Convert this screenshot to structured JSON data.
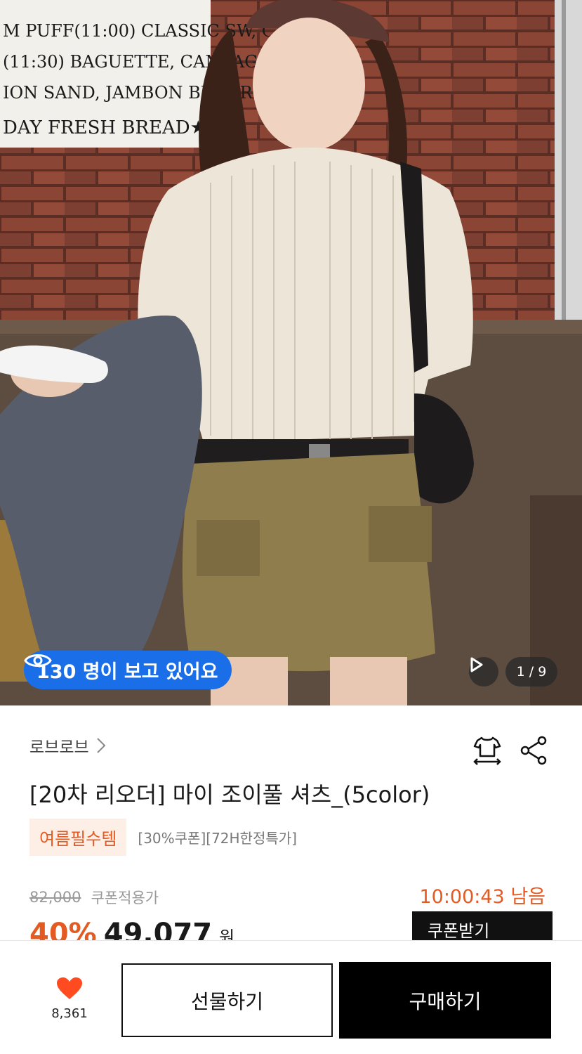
{
  "hero": {
    "viewers_text": "130 명이 보고 있어요",
    "page_indicator": "1 / 9",
    "sign_lines": [
      "M PUFF(11:00) CLASSIC SW, CAFE",
      "(11:30) BAGUETTE, CAMPAGNE",
      "ION SAND, JAMBON BEURRE B",
      "DAY FRESH BREAD★"
    ]
  },
  "product": {
    "brand": "로브로브",
    "title": "[20차 리오더] 마이 조이풀 셔츠_(5color)",
    "tag": "여름필수템",
    "tag_extra": "[30%쿠폰][72H한정특가]",
    "original_price": "82,000",
    "price_label": "쿠폰적용가",
    "timer": "10:00:43 남음",
    "discount": "40%",
    "sale_price": "49,077",
    "currency": "원",
    "coupon_button": "쿠폰받기"
  },
  "bottom_bar": {
    "like_count": "8,361",
    "gift_label": "선물하기",
    "buy_label": "구매하기"
  },
  "colors": {
    "accent": "#e35a22",
    "viewers_pill": "#1a6fe8",
    "heart": "#ff4b1f"
  }
}
